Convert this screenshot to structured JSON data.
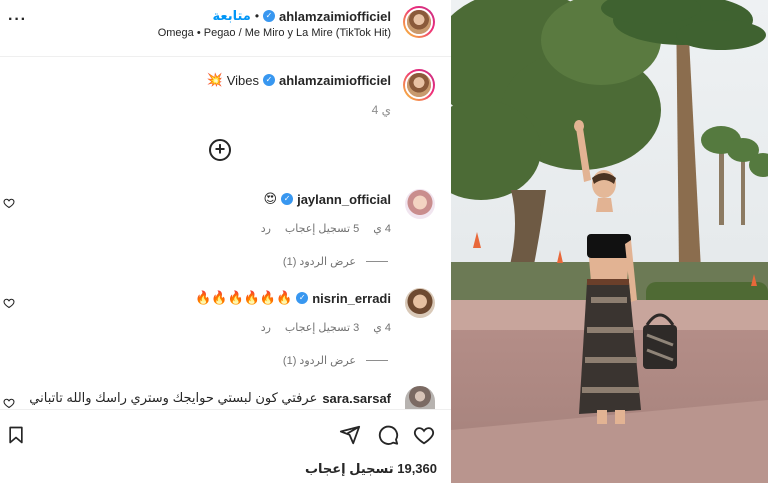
{
  "header": {
    "username": "ahlamzaimiofficiel",
    "separator": "•",
    "follow_label": "متابعة",
    "song": "Omega • Pegao / Me Miro y La Mire (TikTok Hit)",
    "more_label": "···"
  },
  "caption": {
    "username": "ahlamzaimiofficiel",
    "text": "Vibes",
    "emoji": "💥",
    "time": "4 ي"
  },
  "add_label": "+",
  "comments": [
    {
      "username": "jaylann_official",
      "emoji": "😍",
      "time": "4 ي",
      "likes": "5 تسجيل إعجاب",
      "reply": "رد",
      "view_replies": "عرض الردود (1)"
    },
    {
      "username": "nisrin_erradi",
      "emoji": "🔥🔥🔥🔥🔥🔥",
      "time": "4 ي",
      "likes": "3 تسجيل إعجاب",
      "reply": "رد",
      "view_replies": "عرض الردود (1)"
    },
    {
      "username": "sara.sarsaf",
      "text": "عرفتي كون لبستي حوايجك وستري راسك والله تاتباني"
    }
  ],
  "footer": {
    "likes_count": "19,360 تسجيل إعجاب"
  },
  "colors": {
    "accent": "#0095f6",
    "verified": "#3897f0",
    "text": "#262626",
    "muted": "#737373"
  },
  "icons": {
    "more": "more-icon",
    "verified": "verified-badge-icon",
    "add": "add-circle-icon",
    "heart": "heart-icon",
    "share": "share-icon",
    "comment": "comment-icon",
    "save": "bookmark-icon"
  }
}
